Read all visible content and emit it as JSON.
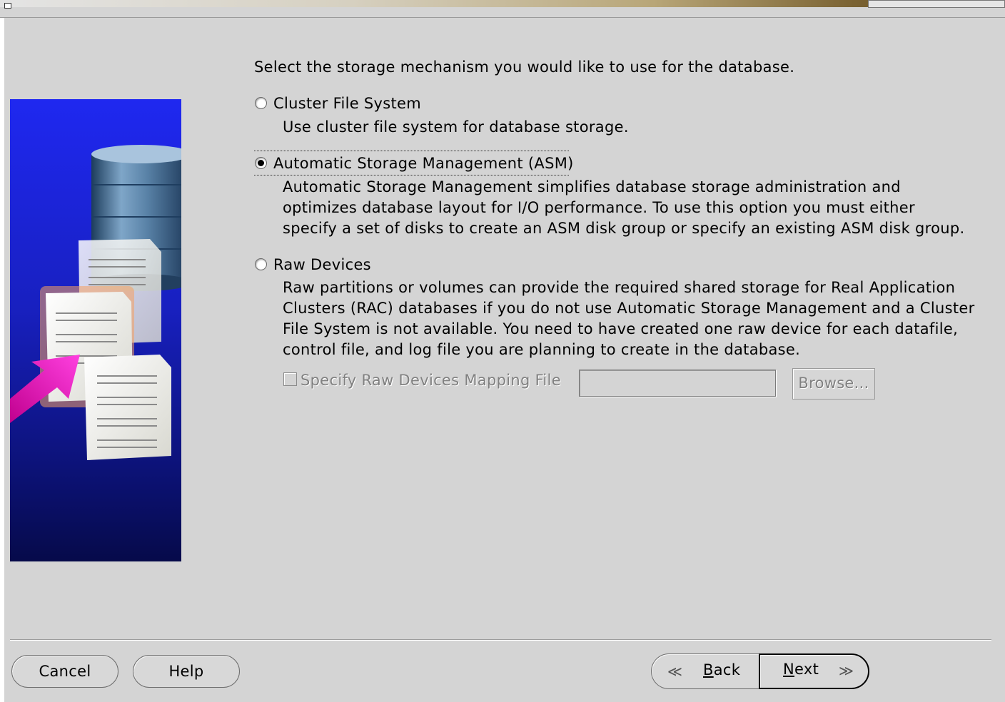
{
  "prompt": "Select the storage mechanism you would like to use for the database.",
  "options": [
    {
      "label": "Cluster File System",
      "selected": false,
      "description": [
        "Use cluster file system for database storage."
      ]
    },
    {
      "label": "Automatic Storage Management (ASM)",
      "selected": true,
      "description": [
        "Automatic Storage Management simplifies database storage administration and",
        "optimizes database layout for I/O performance. To use this option you must either",
        "specify a set of disks to create an ASM disk group or specify an existing ASM disk group."
      ]
    },
    {
      "label": "Raw Devices",
      "selected": false,
      "description": [
        "Raw partitions or volumes can provide the required shared storage for Real Application",
        "Clusters (RAC) databases if you do not use Automatic Storage Management and a Cluster",
        "File System is not available.  You need to have created one raw device for each datafile,",
        "control file, and log file you are planning to create in the database."
      ]
    }
  ],
  "raw_mapping": {
    "checkbox_label": "Specify Raw Devices Mapping File",
    "checked": false,
    "enabled": false,
    "file_value": "",
    "browse_label": "Browse..."
  },
  "buttons": {
    "cancel": "Cancel",
    "help": "Help",
    "back_mnemonic": "B",
    "back_rest": "ack",
    "next_mnemonic": "N",
    "next_rest": "ext"
  },
  "icons": {
    "illustration": "database-storage-illustration",
    "back": "chevron-left-icon",
    "next": "chevron-right-icon"
  },
  "colors": {
    "background": "#d4d4d4",
    "illustration_blue": "#1f28f0",
    "arrow_magenta": "#ff1ed2",
    "disabled_text": "#808080"
  }
}
